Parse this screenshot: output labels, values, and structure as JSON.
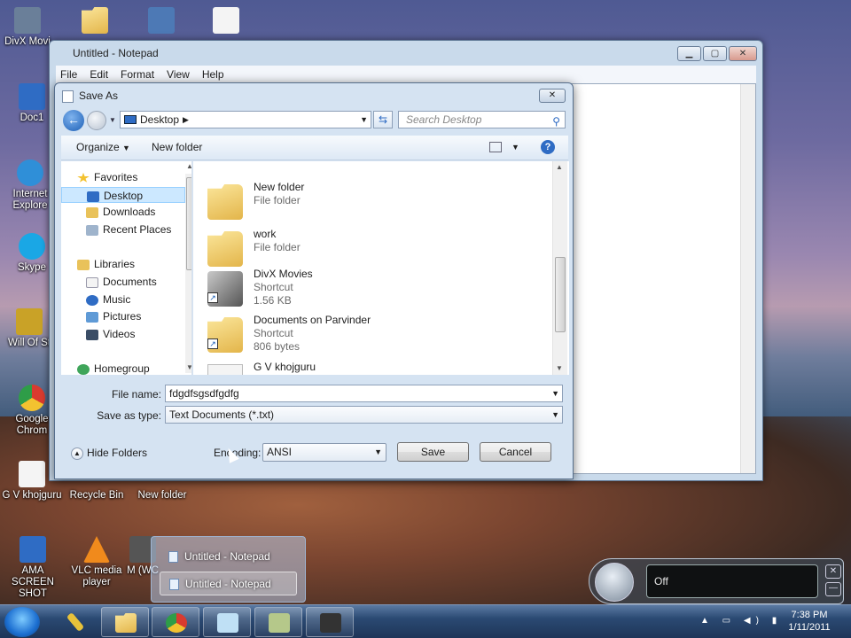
{
  "desktop": {
    "icons": [
      {
        "label": "DivX Movi",
        "color": "#6a7f99"
      },
      {
        "label": "Doc1",
        "color": "#2f6cc4"
      },
      {
        "label": "Internet Explore",
        "color": "#2f8fd8"
      },
      {
        "label": "Skype",
        "color": "#1aa7e5"
      },
      {
        "label": "Will Of St",
        "color": "#c9a227"
      },
      {
        "label": "Google Chrom",
        "color": "#d93b2f"
      },
      {
        "label": "G V khojguru",
        "color": "#f4f4f4"
      },
      {
        "label": "Recycle Bin",
        "color": "#b7c6d8"
      },
      {
        "label": "New folder",
        "color": "#e9c25a"
      },
      {
        "label": "AMA SCREEN SHOT",
        "color": "#2f6cc4"
      },
      {
        "label": "VLC media player",
        "color": "#f08a1c"
      },
      {
        "label": "M (WC",
        "color": "#555555"
      }
    ]
  },
  "notepad": {
    "title": "Untitled - Notepad",
    "menu": [
      "File",
      "Edit",
      "Format",
      "View",
      "Help"
    ]
  },
  "dialog": {
    "title": "Save As",
    "address": "Desktop",
    "search_placeholder": "Search Desktop",
    "organize": "Organize",
    "new_folder": "New folder",
    "nav": {
      "favorites": "Favorites",
      "desktop": "Desktop",
      "downloads": "Downloads",
      "recent": "Recent Places",
      "libraries": "Libraries",
      "documents": "Documents",
      "music": "Music",
      "pictures": "Pictures",
      "videos": "Videos",
      "homegroup": "Homegroup"
    },
    "files": [
      {
        "name": "New folder",
        "line1": "File folder",
        "line2": ""
      },
      {
        "name": "work",
        "line1": "File folder",
        "line2": ""
      },
      {
        "name": "DivX Movies",
        "line1": "Shortcut",
        "line2": "1.56 KB"
      },
      {
        "name": "Documents on Parvinder",
        "line1": "Shortcut",
        "line2": "806 bytes"
      },
      {
        "name": "G V khojguru",
        "line1": "",
        "line2": ""
      }
    ],
    "file_name_label": "File name:",
    "file_name_value": "fdgdfsgsdfgdfg",
    "save_type_label": "Save as type:",
    "save_type_value": "Text Documents (*.txt)",
    "hide_folders": "Hide Folders",
    "encoding_label": "Encoding:",
    "encoding_value": "ANSI",
    "save_button": "Save",
    "cancel_button": "Cancel"
  },
  "taskbar": {
    "popup_items": [
      "Untitled - Notepad",
      "Untitled - Notepad"
    ],
    "clock_time": "7:38 PM",
    "clock_date": "1/11/2011"
  },
  "speech": {
    "status": "Off"
  }
}
